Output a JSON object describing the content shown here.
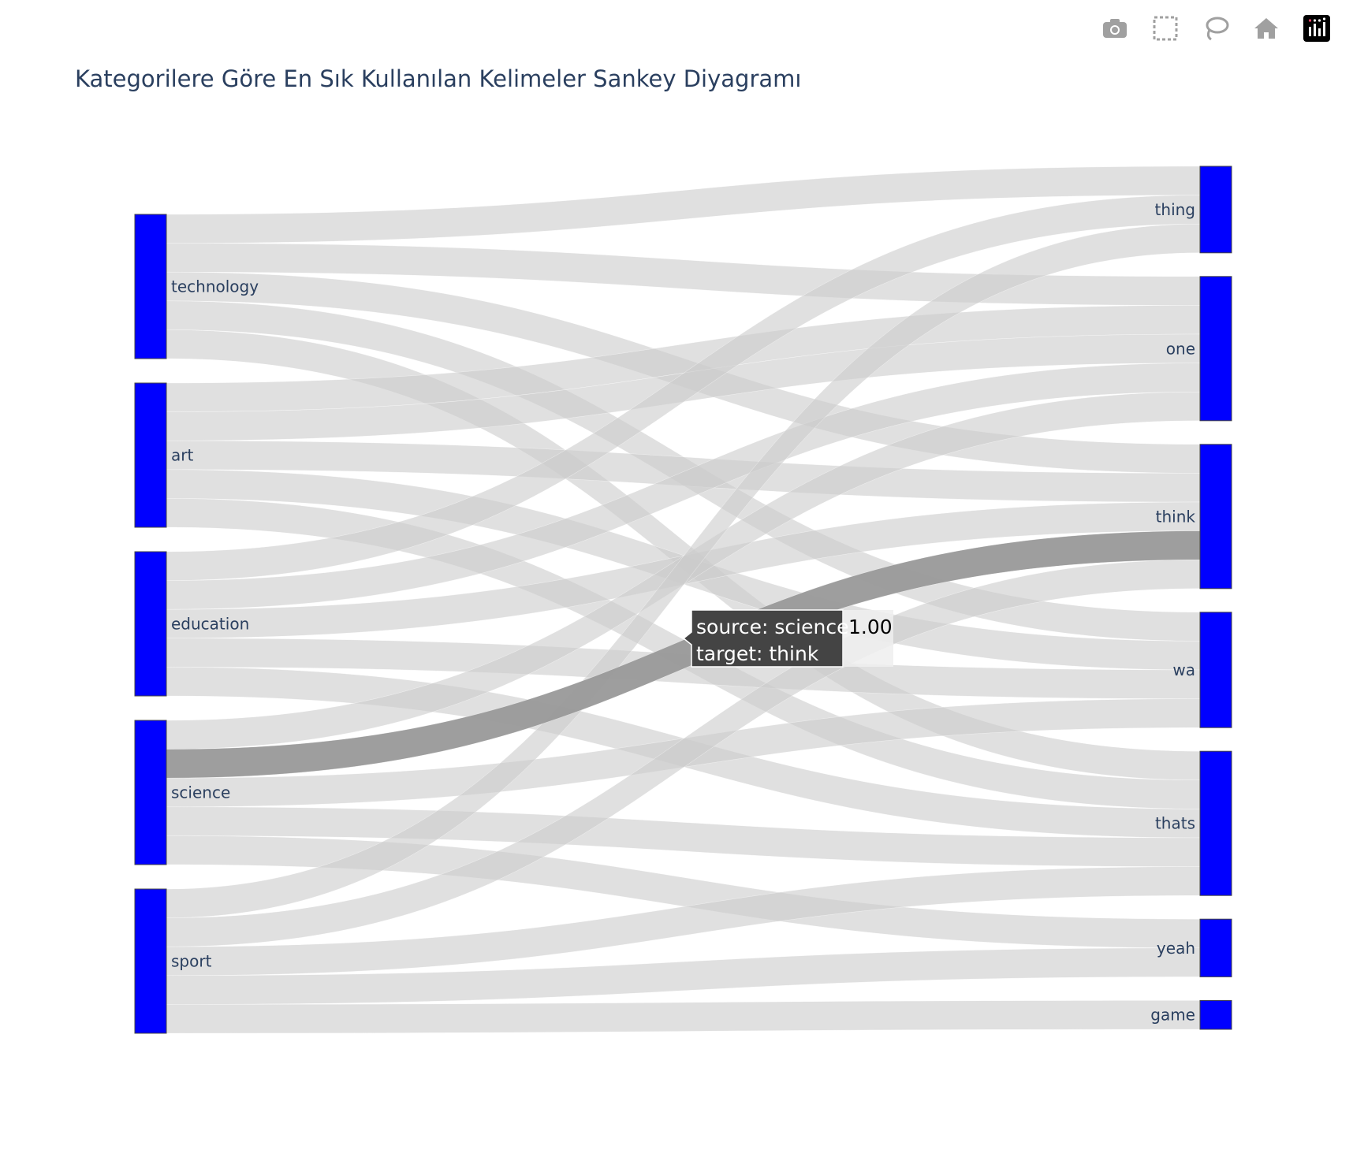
{
  "chart_data": {
    "type": "sankey",
    "title": "Kategorilere Göre En Sık Kullanılan Kelimeler Sankey Diyagramı",
    "sources": [
      "technology",
      "art",
      "education",
      "science",
      "sport"
    ],
    "targets": [
      "thing",
      "one",
      "think",
      "wa",
      "thats",
      "yeah",
      "game"
    ],
    "links": [
      {
        "source": "technology",
        "target": "thing",
        "value": 1
      },
      {
        "source": "technology",
        "target": "one",
        "value": 1
      },
      {
        "source": "technology",
        "target": "think",
        "value": 1
      },
      {
        "source": "technology",
        "target": "wa",
        "value": 1
      },
      {
        "source": "technology",
        "target": "thats",
        "value": 1
      },
      {
        "source": "art",
        "target": "one",
        "value": 1
      },
      {
        "source": "art",
        "target": "one",
        "value": 1
      },
      {
        "source": "art",
        "target": "think",
        "value": 1
      },
      {
        "source": "art",
        "target": "wa",
        "value": 1
      },
      {
        "source": "art",
        "target": "thats",
        "value": 1
      },
      {
        "source": "education",
        "target": "thing",
        "value": 1
      },
      {
        "source": "education",
        "target": "one",
        "value": 1
      },
      {
        "source": "education",
        "target": "think",
        "value": 1
      },
      {
        "source": "education",
        "target": "wa",
        "value": 1
      },
      {
        "source": "education",
        "target": "thats",
        "value": 1
      },
      {
        "source": "science",
        "target": "one",
        "value": 1
      },
      {
        "source": "science",
        "target": "think",
        "value": 1
      },
      {
        "source": "science",
        "target": "wa",
        "value": 1
      },
      {
        "source": "science",
        "target": "thats",
        "value": 1
      },
      {
        "source": "science",
        "target": "yeah",
        "value": 1
      },
      {
        "source": "sport",
        "target": "thing",
        "value": 1
      },
      {
        "source": "sport",
        "target": "think",
        "value": 1
      },
      {
        "source": "sport",
        "target": "thats",
        "value": 1
      },
      {
        "source": "sport",
        "target": "yeah",
        "value": 1
      },
      {
        "source": "sport",
        "target": "game",
        "value": 1
      }
    ],
    "highlighted_link": {
      "source": "science",
      "target": "think",
      "value": 1
    },
    "node_color": "#0000ff",
    "link_color": "#cccccc",
    "highlight_color": "#999999"
  },
  "tooltip": {
    "line1": "source: science",
    "line2": "target: think",
    "value": "1.00"
  },
  "modebar": {
    "icons": [
      "camera-icon",
      "box-select-icon",
      "lasso-icon",
      "home-icon",
      "plotly-logo-icon"
    ]
  }
}
